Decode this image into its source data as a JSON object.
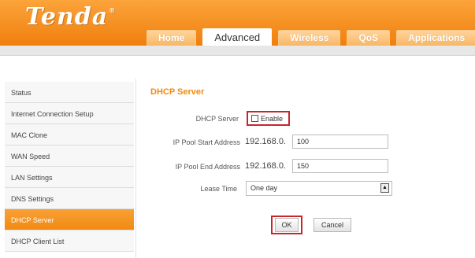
{
  "brand": {
    "logo": "Tenda",
    "mark": "®"
  },
  "nav": {
    "tabs": [
      {
        "label": "Home",
        "active": false
      },
      {
        "label": "Advanced",
        "active": true
      },
      {
        "label": "Wireless",
        "active": false
      },
      {
        "label": "QoS",
        "active": false
      },
      {
        "label": "Applications",
        "active": false
      }
    ]
  },
  "sidebar": {
    "items": [
      {
        "label": "Status",
        "active": false
      },
      {
        "label": "Internet Connection Setup",
        "active": false
      },
      {
        "label": "MAC Clone",
        "active": false
      },
      {
        "label": "WAN Speed",
        "active": false
      },
      {
        "label": "LAN Settings",
        "active": false
      },
      {
        "label": "DNS Settings",
        "active": false
      },
      {
        "label": "DHCP Server",
        "active": true
      },
      {
        "label": "DHCP Client List",
        "active": false
      }
    ]
  },
  "form": {
    "title": "DHCP Server",
    "dhcp_server_label": "DHCP Server",
    "enable_label": "Enable",
    "enable_checked": false,
    "start_label": "IP Pool Start Address",
    "start_prefix": "192.168.0.",
    "start_value": "100",
    "end_label": "IP Pool End Address",
    "end_prefix": "192.168.0.",
    "end_value": "150",
    "lease_label": "Lease Time",
    "lease_value": "One day",
    "ok_label": "OK",
    "cancel_label": "Cancel"
  },
  "colors": {
    "brand_orange": "#f08a0f",
    "highlight_red": "#c8262d"
  }
}
